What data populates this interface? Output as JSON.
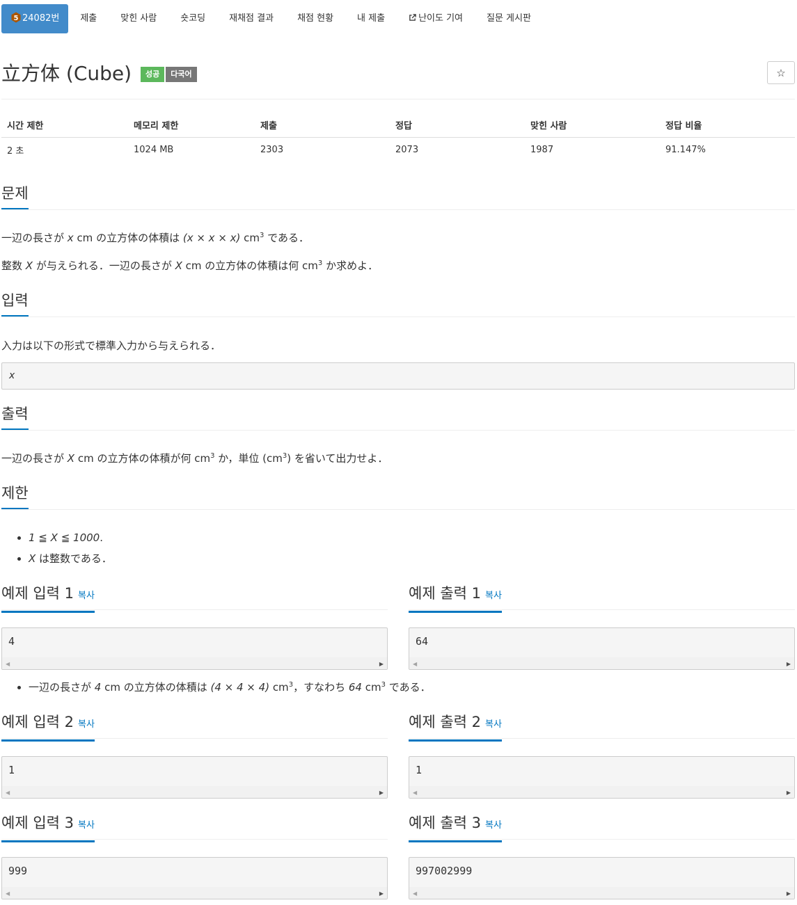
{
  "nav": {
    "problem_id": "24082번",
    "submit": "제출",
    "solved_users": "맞힌 사람",
    "short_coding": "숏코딩",
    "rejudge_result": "재채점 결과",
    "judge_status": "채점 현황",
    "my_submissions": "내 제출",
    "contribute_difficulty": "난이도 기여",
    "question_board": "질문 게시판",
    "tier_badge": "5",
    "tier_color": "#ad5600"
  },
  "problem": {
    "title": "立方体 (Cube)",
    "badge_success": "성공",
    "badge_multilang": "다국어",
    "star": "☆"
  },
  "info": {
    "headers": [
      "시간 제한",
      "메모리 제한",
      "제출",
      "정답",
      "맞힌 사람",
      "정답 비율"
    ],
    "values": [
      "2 초",
      "1024 MB",
      "2303",
      "2073",
      "1987",
      "91.147%"
    ]
  },
  "sections": {
    "problem": "문제",
    "input": "입력",
    "output": "출력",
    "limit": "제한"
  },
  "statement": {
    "line1": [
      "一辺の長さが ",
      "x",
      " cm の立方体の体積は ",
      "(x × x × x)",
      " cm",
      "3",
      " である．"
    ],
    "line2": [
      "整数 ",
      "X",
      " が与えられる．一辺の長さが ",
      "X",
      " cm の立方体の体積は何 cm",
      "3",
      " か求めよ．"
    ]
  },
  "input_desc": {
    "text": "入力は以下の形式で標準入力から与えられる．",
    "format": "x"
  },
  "output_desc": [
    "一辺の長さが ",
    "X",
    " cm の立方体の体積が何 cm",
    "3",
    " か，単位 (cm",
    "3",
    ") を省いて出力せよ．"
  ],
  "limits": [
    [
      "1 ≦ X ≦ 1000",
      "."
    ],
    [
      "X",
      " は整数である．"
    ]
  ],
  "samples": {
    "copy_label": "복사",
    "items": [
      {
        "input_title": "예제 입력 1",
        "output_title": "예제 출력 1",
        "input": "4",
        "output": "64"
      },
      {
        "input_title": "예제 입력 2",
        "output_title": "예제 출력 2",
        "input": "1",
        "output": "1"
      },
      {
        "input_title": "예제 입력 3",
        "output_title": "예제 출력 3",
        "input": "999",
        "output": "997002999"
      }
    ],
    "note1": [
      "一辺の長さが ",
      "4",
      " cm の立方体の体積は ",
      "(4 × 4 × 4)",
      " cm",
      "3",
      "，すなわち ",
      "64",
      " cm",
      "3",
      " である．"
    ]
  },
  "colors": {
    "accent": "#0076c0",
    "nav_active": "#428bca",
    "success": "#5cb85c",
    "lang_badge": "#777777"
  }
}
